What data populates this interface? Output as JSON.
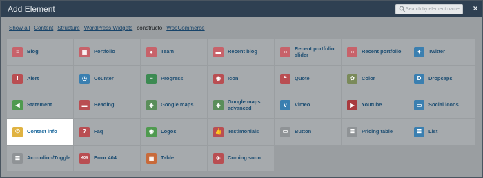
{
  "header": {
    "title": "Add Element",
    "search_placeholder": "Search by element name",
    "close_label": "×"
  },
  "filters": [
    {
      "label": "Show all",
      "active": false
    },
    {
      "label": "Content",
      "active": false
    },
    {
      "label": "Structure",
      "active": false
    },
    {
      "label": "WordPress Widgets",
      "active": false
    },
    {
      "label": "constructo",
      "active": true
    },
    {
      "label": "WooCommerce",
      "active": false
    }
  ],
  "elements": [
    {
      "label": "Blog",
      "icon": "blog-icon",
      "color": "#c7626a",
      "glyph": "≡"
    },
    {
      "label": "Portfolio",
      "icon": "portfolio-icon",
      "color": "#c7626a",
      "glyph": "▦"
    },
    {
      "label": "Team",
      "icon": "team-icon",
      "color": "#c7626a",
      "glyph": "●"
    },
    {
      "label": "Recent blog",
      "icon": "recent-blog-icon",
      "color": "#c7626a",
      "glyph": "▬"
    },
    {
      "label": "Recent portfolio slider",
      "icon": "recent-portfolio-slider-icon",
      "color": "#c7626a",
      "glyph": "▪▪"
    },
    {
      "label": "Recent portfolio",
      "icon": "recent-portfolio-icon",
      "color": "#c7626a",
      "glyph": "▪▪"
    },
    {
      "label": "Twitter",
      "icon": "twitter-icon",
      "color": "#3a7fb0",
      "glyph": "✦"
    },
    {
      "label": "Alert",
      "icon": "alert-icon",
      "color": "#b94e52",
      "glyph": "!"
    },
    {
      "label": "Counter",
      "icon": "counter-icon",
      "color": "#3a7fb0",
      "glyph": "◷"
    },
    {
      "label": "Progress",
      "icon": "progress-icon",
      "color": "#3c8a52",
      "glyph": "≡"
    },
    {
      "label": "Icon",
      "icon": "icon-element-icon",
      "color": "#b94e52",
      "glyph": "◉"
    },
    {
      "label": "Quote",
      "icon": "quote-icon",
      "color": "#b94e52",
      "glyph": "❝"
    },
    {
      "label": "Color",
      "icon": "color-icon",
      "color": "#7a8a5a",
      "glyph": "✿"
    },
    {
      "label": "Dropcaps",
      "icon": "dropcaps-icon",
      "color": "#3a7fb0",
      "glyph": "D"
    },
    {
      "label": "Statement",
      "icon": "statement-icon",
      "color": "#4f9a4f",
      "glyph": "◀"
    },
    {
      "label": "Heading",
      "icon": "heading-icon",
      "color": "#b94e52",
      "glyph": "▬"
    },
    {
      "label": "Google maps",
      "icon": "google-maps-icon",
      "color": "#5a8e5a",
      "glyph": "◈"
    },
    {
      "label": "Google maps advanced",
      "icon": "google-maps-advanced-icon",
      "color": "#5a8e5a",
      "glyph": "◈"
    },
    {
      "label": "Vimeo",
      "icon": "vimeo-icon",
      "color": "#3a7fb0",
      "glyph": "v"
    },
    {
      "label": "Youtube",
      "icon": "youtube-icon",
      "color": "#a83a3e",
      "glyph": "▶"
    },
    {
      "label": "Social icons",
      "icon": "social-icons-icon",
      "color": "#3a7fb0",
      "glyph": "▭"
    },
    {
      "label": "Contact info",
      "icon": "contact-info-icon",
      "color": "#e0b342",
      "glyph": "✆"
    },
    {
      "label": "Faq",
      "icon": "faq-icon",
      "color": "#b94e52",
      "glyph": "?"
    },
    {
      "label": "Logos",
      "icon": "logos-icon",
      "color": "#4f9a4f",
      "glyph": "◉"
    },
    {
      "label": "Testimonials",
      "icon": "testimonials-icon",
      "color": "#b94e52",
      "glyph": "👍"
    },
    {
      "label": "Button",
      "icon": "button-icon",
      "color": "#8f9396",
      "glyph": "▭"
    },
    {
      "label": "Pricing table",
      "icon": "pricing-table-icon",
      "color": "#8f9396",
      "glyph": "☰"
    },
    {
      "label": "List",
      "icon": "list-icon",
      "color": "#3a7fb0",
      "glyph": "☰"
    },
    {
      "label": "Accordion/Toggle",
      "icon": "accordion-toggle-icon",
      "color": "#8f9396",
      "glyph": "☰"
    },
    {
      "label": "Error 404",
      "icon": "error-404-icon",
      "color": "#b94e52",
      "glyph": "404"
    },
    {
      "label": "Table",
      "icon": "table-icon",
      "color": "#c86a3a",
      "glyph": "▦"
    },
    {
      "label": "Coming soon",
      "icon": "coming-soon-icon",
      "color": "#b94e52",
      "glyph": "✈"
    }
  ],
  "highlighted": "Contact info"
}
